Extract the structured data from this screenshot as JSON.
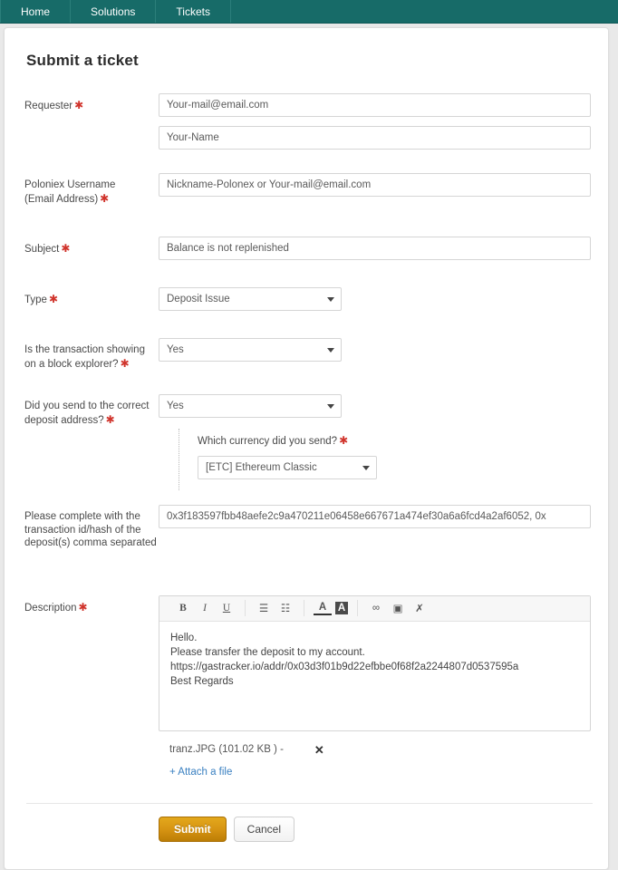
{
  "nav": {
    "items": [
      {
        "label": "Home",
        "name": "nav-item-home"
      },
      {
        "label": "Solutions",
        "name": "nav-item-solutions"
      },
      {
        "label": "Tickets",
        "name": "nav-item-tickets"
      }
    ],
    "background_color": "#176b68"
  },
  "page": {
    "title": "Submit a ticket"
  },
  "form": {
    "requester": {
      "label": "Requester",
      "required": true,
      "email_value": "Your-mail@email.com",
      "email_placeholder": "Your-mail@email.com",
      "name_value": "Your-Name",
      "name_placeholder": "Your-Name"
    },
    "poloniex_username": {
      "label_line1": "Poloniex Username",
      "label_line2": "(Email Address)",
      "required": true,
      "value": "Nickname-Polonex or Your-mail@email.com",
      "placeholder": "Nickname-Polonex or Your-mail@email.com"
    },
    "subject": {
      "label": "Subject",
      "required": true,
      "value": "Balance is not replenished"
    },
    "type": {
      "label": "Type",
      "required": true,
      "selected": "Deposit Issue"
    },
    "block_explorer": {
      "label": "Is the transaction showing on a block explorer?",
      "required": true,
      "selected": "Yes"
    },
    "correct_address": {
      "label": "Did you send to the correct deposit address?",
      "required": true,
      "selected": "Yes",
      "nested": {
        "label": "Which currency did you send?",
        "required": true,
        "selected": "[ETC] Ethereum Classic"
      }
    },
    "transaction_hash": {
      "label": "Please complete with the transaction id/hash of the deposit(s) comma separated",
      "required": false,
      "value": "0x3f183597fbb48aefe2c9a470211e06458e667671a474ef30a6a6fcd4a2af6052, 0x"
    },
    "description": {
      "label": "Description",
      "required": true,
      "toolbar": [
        {
          "name": "bold-icon",
          "glyph": "B"
        },
        {
          "name": "italic-icon",
          "glyph": "I"
        },
        {
          "name": "underline-icon",
          "glyph": "U"
        },
        {
          "name": "bullet-list-icon",
          "glyph": "☰"
        },
        {
          "name": "numbered-list-icon",
          "glyph": "☷"
        },
        {
          "name": "font-color-icon",
          "glyph": "A"
        },
        {
          "name": "highlight-color-icon",
          "glyph": "A"
        },
        {
          "name": "insert-link-icon",
          "glyph": "∞"
        },
        {
          "name": "insert-image-icon",
          "glyph": "▣"
        },
        {
          "name": "clear-formatting-icon",
          "glyph": "✗"
        }
      ],
      "body_lines": [
        "Hello.",
        "Please transfer the deposit to my account.",
        "https://gastracker.io/addr/0x03d3f01b9d22efbbe0f68f2a2244807d0537595a",
        "Best Regards"
      ]
    },
    "attachments": {
      "file_label": "tranz.JPG (101.02 KB ) -",
      "remove_glyph": "✕",
      "attach_link": "+ Attach a file",
      "attach_link_color": "#3a80c1"
    },
    "actions": {
      "submit_label": "Submit",
      "cancel_label": "Cancel",
      "submit_color": "#d79513"
    }
  }
}
